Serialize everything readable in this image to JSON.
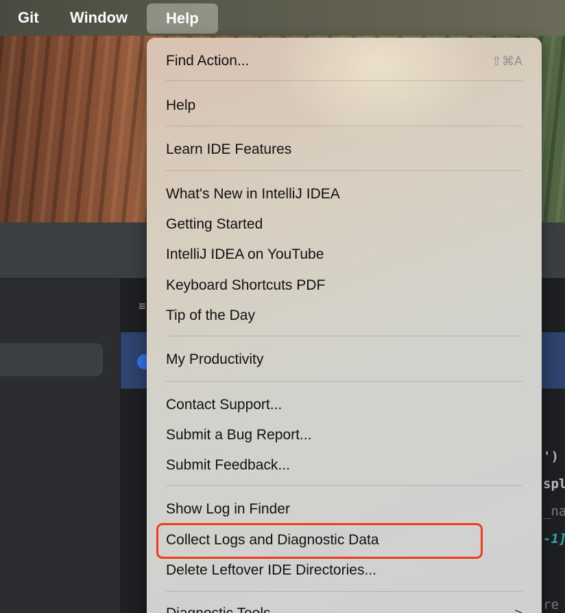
{
  "menubar": {
    "git": "Git",
    "window": "Window",
    "help": "Help"
  },
  "ide": {
    "code_fragments": [
      "')",
      "spl",
      "_na",
      "-1]",
      "re"
    ]
  },
  "help_menu": {
    "find_action": {
      "label": "Find Action...",
      "shortcut": "⇧⌘A"
    },
    "help": "Help",
    "learn_ide_features": "Learn IDE Features",
    "whats_new": "What's New in IntelliJ IDEA",
    "getting_started": "Getting Started",
    "youtube": "IntelliJ IDEA on YouTube",
    "keyboard_shortcuts_pdf": "Keyboard Shortcuts PDF",
    "tip_of_the_day": "Tip of the Day",
    "my_productivity": "My Productivity",
    "contact_support": "Contact Support...",
    "submit_bug_report": "Submit a Bug Report...",
    "submit_feedback": "Submit Feedback...",
    "show_log_in_finder": "Show Log in Finder",
    "collect_logs": "Collect Logs and Diagnostic Data",
    "delete_leftover": "Delete Leftover IDE Directories...",
    "diagnostic_tools": "Diagnostic Tools"
  },
  "colors": {
    "highlight_box": "#ee3b1a",
    "ide_selection": "#2e436e",
    "ide_accent": "#3574f0"
  }
}
